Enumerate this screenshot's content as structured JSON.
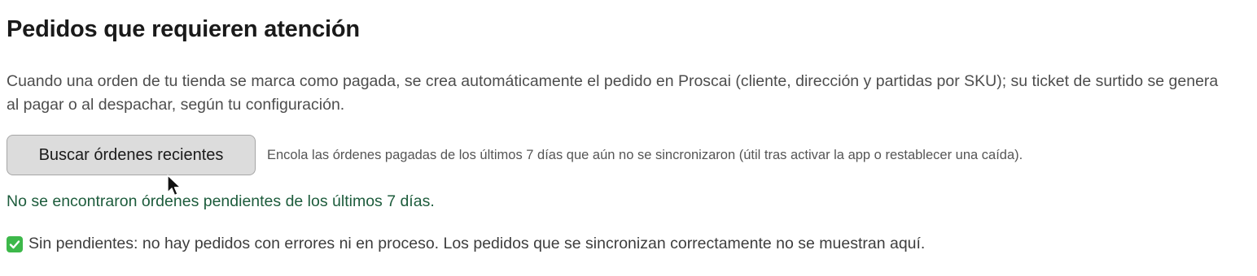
{
  "section": {
    "title": "Pedidos que requieren atención",
    "description": "Cuando una orden de tu tienda se marca como pagada, se crea automáticamente el pedido en Proscai (cliente, dirección y partidas por SKU); su ticket de surtido se genera al pagar o al despachar, según tu configuración."
  },
  "actions": {
    "fetch_button_label": "Buscar órdenes recientes",
    "fetch_button_help": "Encola las órdenes pagadas de los últimos 7 días que aún no se sincronizaron (útil tras activar la app o restablecer una caída)."
  },
  "result": {
    "message": "No se encontraron órdenes pendientes de los últimos 7 días."
  },
  "status": {
    "icon": "check-mark-icon",
    "text": "Sin pendientes: no hay pedidos con errores ni en proceso. Los pedidos que se sincronizan correctamente no se muestran aquí."
  },
  "colors": {
    "result_text": "#1d5c3c",
    "check_icon": "#3db84a",
    "button_background": "#dcdcdc"
  }
}
